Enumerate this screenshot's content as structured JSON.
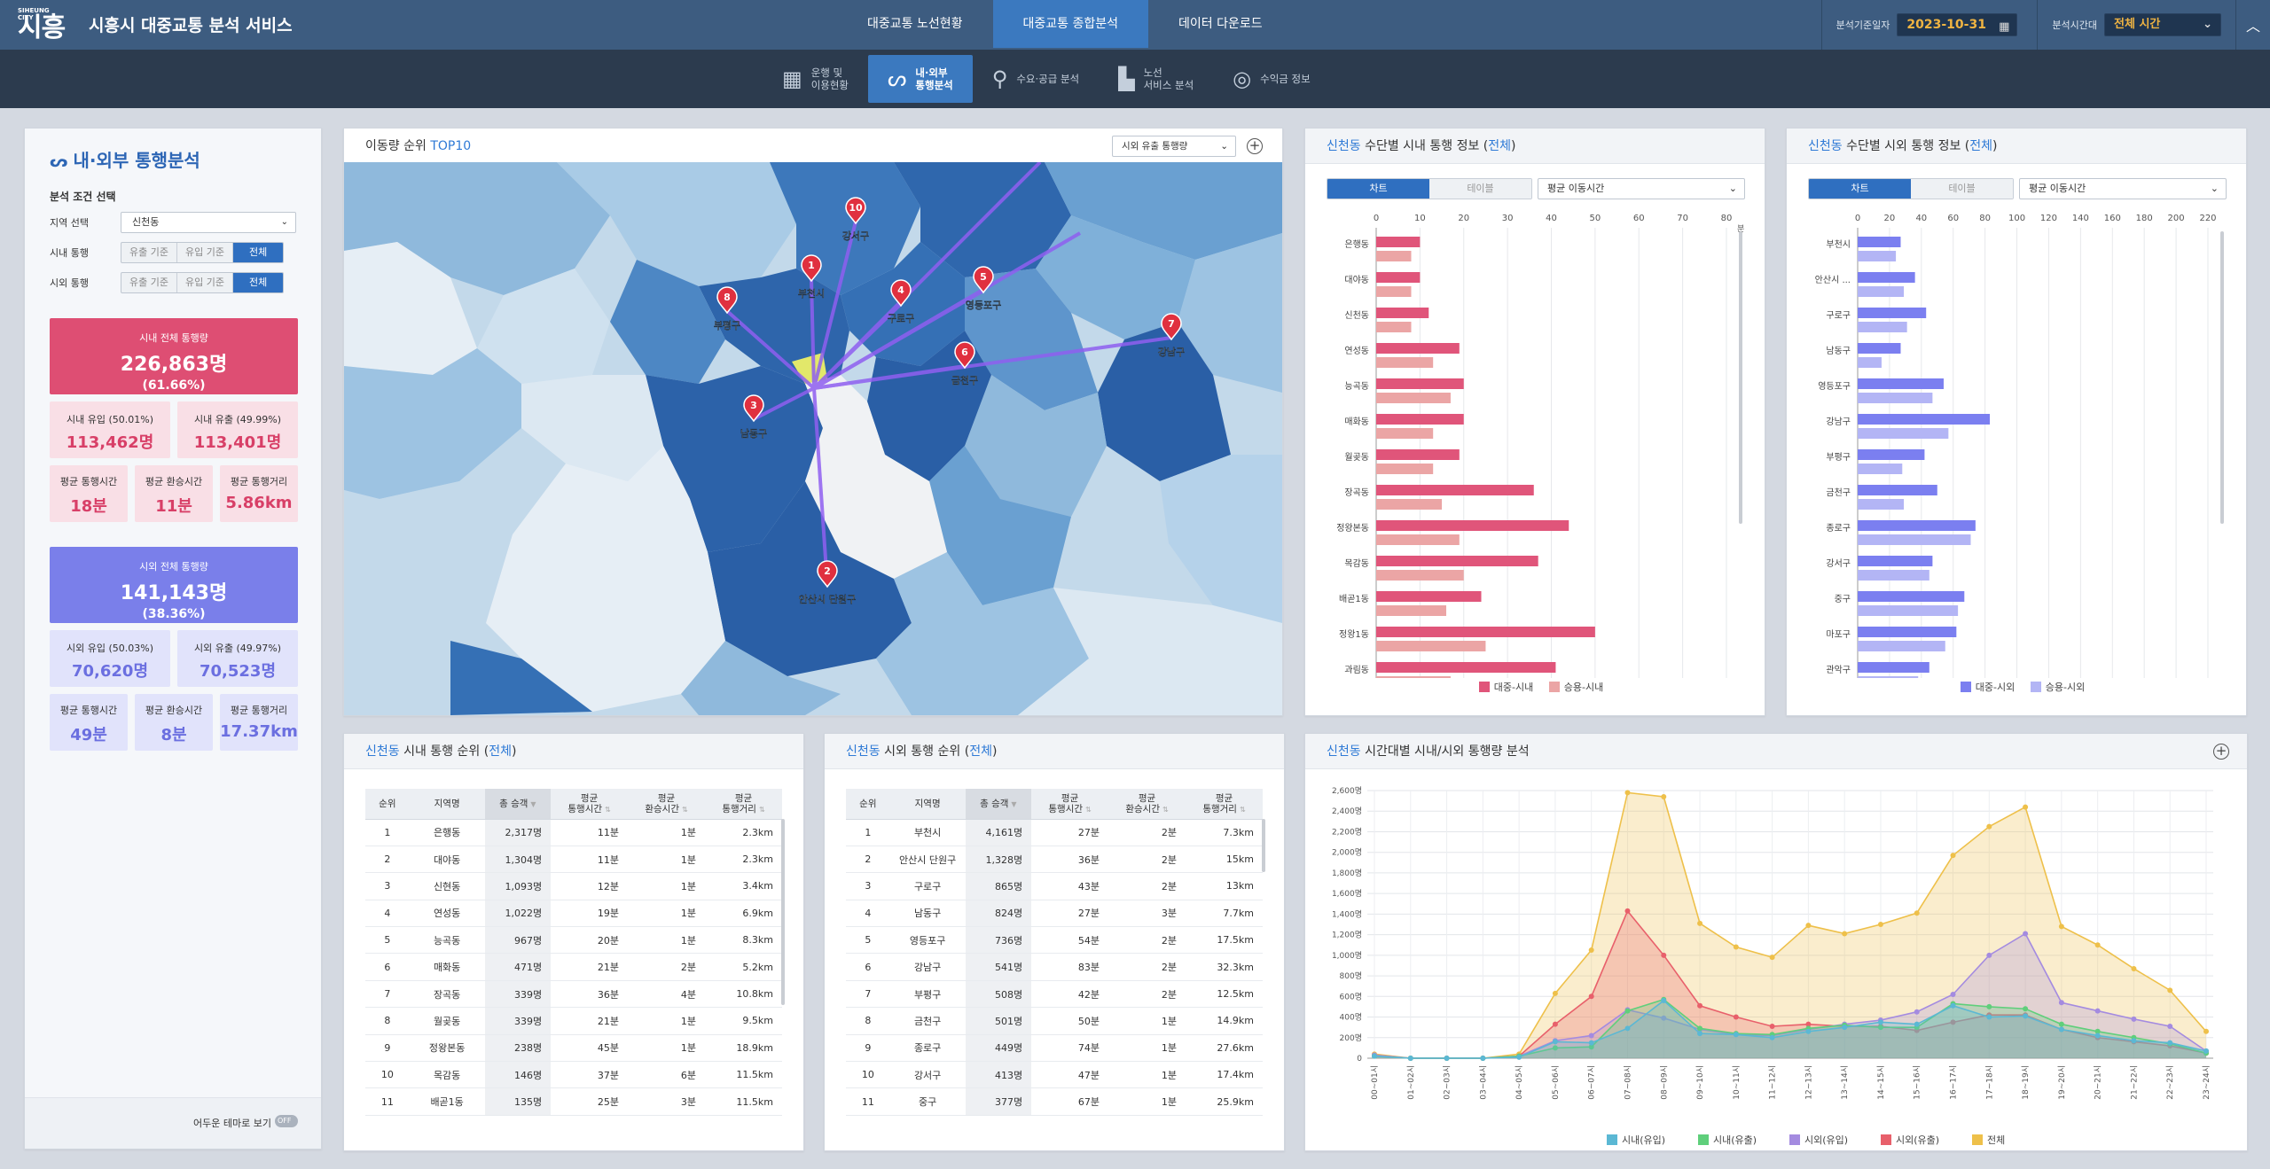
{
  "header": {
    "logo_small": "SIHEUNG CITY",
    "logo": "시흥",
    "title": "시흥시 대중교통 분석 서비스",
    "nav": [
      "대중교통 노선현황",
      "대중교통 종합분석",
      "데이터 다운로드"
    ],
    "date_label": "분석기준일자",
    "date": "2023-10-31",
    "time_label": "분석시간대",
    "time": "전체 시간"
  },
  "subnav": [
    [
      "운행 및",
      "이용현황"
    ],
    [
      "내·외부",
      "통행분석"
    ],
    [
      "수요·공급 분석",
      ""
    ],
    [
      "노선",
      "서비스 분석"
    ],
    [
      "수익금 정보",
      ""
    ]
  ],
  "left": {
    "title": "내·외부 통행분석",
    "cond": "분석 조건 선택",
    "region_label": "지역 선택",
    "region": "신천동",
    "inner_label": "시내 통행",
    "outer_label": "시외 통행",
    "seg": [
      "유출 기준",
      "유입 기준",
      "전체"
    ],
    "inner_total_label": "시내 전체 통행량",
    "inner_total": "226,863명",
    "inner_total_pct": "(61.66%)",
    "inner_in_label": "시내 유입 (50.01%)",
    "inner_in": "113,462명",
    "inner_out_label": "시내 유출 (49.99%)",
    "inner_out": "113,401명",
    "inner_stats": [
      [
        "평균 통행시간",
        "18분"
      ],
      [
        "평균 환승시간",
        "11분"
      ],
      [
        "평균 통행거리",
        "5.86km"
      ]
    ],
    "outer_total_label": "시외 전체 통행량",
    "outer_total": "141,143명",
    "outer_total_pct": "(38.36%)",
    "outer_in_label": "시외 유입 (50.03%)",
    "outer_in": "70,620명",
    "outer_out_label": "시외 유출 (49.97%)",
    "outer_out": "70,523명",
    "outer_stats": [
      [
        "평균 통행시간",
        "49분"
      ],
      [
        "평균 환승시간",
        "8분"
      ],
      [
        "평균 통행거리",
        "17.37km"
      ]
    ],
    "dark_label": "어두운 테마로 보기",
    "dark_state": "OFF"
  },
  "map": {
    "title_pre": "이동량 순위 ",
    "title_hl": "TOP10",
    "select": "시외 유출 통행량",
    "markers": [
      {
        "n": "1",
        "name": "부천시"
      },
      {
        "n": "2",
        "name": "안산시 단원구"
      },
      {
        "n": "3",
        "name": "남동구"
      },
      {
        "n": "4",
        "name": "구로구"
      },
      {
        "n": "5",
        "name": "영등포구"
      },
      {
        "n": "6",
        "name": "금천구"
      },
      {
        "n": "7",
        "name": "강남구"
      },
      {
        "n": "8",
        "name": "부평구"
      },
      {
        "n": "10",
        "name": "강서구"
      }
    ]
  },
  "inner_chart": {
    "title_pre": "신천동",
    "title_mid": " 수단별 시내 통행 정보 (",
    "title_hl": "전체",
    "title_end": ")",
    "tabs": [
      "차트",
      "테이블"
    ],
    "select": "평균 이동시간",
    "unit": "분",
    "legend": [
      "대중-시내",
      "승용-시내"
    ],
    "colors": [
      "#e0557a",
      "#eba5a5"
    ]
  },
  "outer_chart": {
    "title_pre": "신천동",
    "title_mid": " 수단별 시외 통행 정보 (",
    "title_hl": "전체",
    "title_end": ")",
    "tabs": [
      "차트",
      "테이블"
    ],
    "select": "평균 이동시간",
    "legend": [
      "대중-시외",
      "승용-시외"
    ],
    "colors": [
      "#7b7ff0",
      "#b3b5f5"
    ]
  },
  "inner_table": {
    "title_pre": "신천동",
    "title_mid": " 시내 통행 순위 (",
    "title_hl": "전체",
    "title_end": ")",
    "headers": [
      "순위",
      "지역명",
      "총 승객",
      "평균\n통행시간",
      "평균\n환승시간",
      "평균\n통행거리"
    ],
    "rows": [
      [
        "1",
        "은행동",
        "2,317명",
        "11분",
        "1분",
        "2.3km"
      ],
      [
        "2",
        "대야동",
        "1,304명",
        "11분",
        "1분",
        "2.3km"
      ],
      [
        "3",
        "신현동",
        "1,093명",
        "12분",
        "1분",
        "3.4km"
      ],
      [
        "4",
        "연성동",
        "1,022명",
        "19분",
        "1분",
        "6.9km"
      ],
      [
        "5",
        "능곡동",
        "967명",
        "20분",
        "1분",
        "8.3km"
      ],
      [
        "6",
        "매화동",
        "471명",
        "21분",
        "2분",
        "5.2km"
      ],
      [
        "7",
        "장곡동",
        "339명",
        "36분",
        "4분",
        "10.8km"
      ],
      [
        "8",
        "월곶동",
        "339명",
        "21분",
        "1분",
        "9.5km"
      ],
      [
        "9",
        "정왕본동",
        "238명",
        "45분",
        "1분",
        "18.9km"
      ],
      [
        "10",
        "목감동",
        "146명",
        "37분",
        "6분",
        "11.5km"
      ],
      [
        "11",
        "배곧1동",
        "135명",
        "25분",
        "3분",
        "11.5km"
      ]
    ]
  },
  "outer_table": {
    "title_pre": "신천동",
    "title_mid": " 시외 통행 순위 (",
    "title_hl": "전체",
    "title_end": ")",
    "headers": [
      "순위",
      "지역명",
      "총 승객",
      "평균\n통행시간",
      "평균\n환승시간",
      "평균\n통행거리"
    ],
    "rows": [
      [
        "1",
        "부천시",
        "4,161명",
        "27분",
        "2분",
        "7.3km"
      ],
      [
        "2",
        "안산시 단원구",
        "1,328명",
        "36분",
        "2분",
        "15km"
      ],
      [
        "3",
        "구로구",
        "865명",
        "43분",
        "2분",
        "13km"
      ],
      [
        "4",
        "남동구",
        "824명",
        "27분",
        "3분",
        "7.7km"
      ],
      [
        "5",
        "영등포구",
        "736명",
        "54분",
        "2분",
        "17.5km"
      ],
      [
        "6",
        "강남구",
        "541명",
        "83분",
        "2분",
        "32.3km"
      ],
      [
        "7",
        "부평구",
        "508명",
        "42분",
        "2분",
        "12.5km"
      ],
      [
        "8",
        "금천구",
        "501명",
        "50분",
        "1분",
        "14.9km"
      ],
      [
        "9",
        "종로구",
        "449명",
        "74분",
        "1분",
        "27.6km"
      ],
      [
        "10",
        "강서구",
        "413명",
        "47분",
        "1분",
        "17.4km"
      ],
      [
        "11",
        "중구",
        "377명",
        "67분",
        "1분",
        "25.9km"
      ]
    ]
  },
  "ts": {
    "title_pre": "신천동",
    "title_rest": " 시간대별 시내/시외 통행량 분석"
  },
  "chart_data": [
    {
      "type": "bar",
      "name": "inner",
      "categories": [
        "은행동",
        "대야동",
        "신천동",
        "연성동",
        "능곡동",
        "매화동",
        "월곶동",
        "장곡동",
        "정왕본동",
        "목감동",
        "배곧1동",
        "정왕1동",
        "과림동"
      ],
      "series": [
        {
          "name": "대중-시내",
          "values": [
            10,
            10,
            12,
            19,
            20,
            20,
            19,
            36,
            44,
            37,
            24,
            50,
            41
          ]
        },
        {
          "name": "승용-시내",
          "values": [
            8,
            8,
            8,
            13,
            17,
            13,
            13,
            15,
            19,
            20,
            16,
            25,
            17
          ]
        }
      ],
      "xlim": [
        0,
        80
      ],
      "xticks": [
        0,
        10,
        20,
        30,
        40,
        50,
        60,
        70,
        80
      ]
    },
    {
      "type": "bar",
      "name": "outer",
      "categories": [
        "부천시",
        "안산시 ...",
        "구로구",
        "남동구",
        "영등포구",
        "강남구",
        "부평구",
        "금천구",
        "종로구",
        "강서구",
        "중구",
        "마포구",
        "관악구"
      ],
      "series": [
        {
          "name": "대중-시외",
          "values": [
            27,
            36,
            43,
            27,
            54,
            83,
            42,
            50,
            74,
            47,
            67,
            62,
            45
          ]
        },
        {
          "name": "승용-시외",
          "values": [
            24,
            29,
            31,
            15,
            47,
            57,
            28,
            29,
            71,
            45,
            63,
            55,
            38
          ]
        }
      ],
      "xlim": [
        0,
        220
      ],
      "xticks": [
        0,
        20,
        40,
        60,
        80,
        100,
        120,
        140,
        160,
        180,
        200,
        220
      ]
    },
    {
      "type": "area",
      "name": "hourly",
      "categories": [
        "00~01시",
        "01~02시",
        "02~03시",
        "03~04시",
        "04~05시",
        "05~06시",
        "06~07시",
        "07~08시",
        "08~09시",
        "09~10시",
        "10~11시",
        "11~12시",
        "12~13시",
        "13~14시",
        "14~15시",
        "15~16시",
        "16~17시",
        "17~18시",
        "18~19시",
        "19~20시",
        "20~21시",
        "21~22시",
        "22~23시",
        "23~24시"
      ],
      "series": [
        {
          "name": "시내(유입)",
          "color": "#5bb8d4",
          "values": [
            20,
            0,
            0,
            0,
            10,
            160,
            150,
            290,
            560,
            240,
            230,
            200,
            260,
            300,
            350,
            330,
            510,
            400,
            410,
            280,
            220,
            170,
            150,
            70
          ]
        },
        {
          "name": "시내(유출)",
          "color": "#5fcf7b",
          "values": [
            20,
            0,
            0,
            0,
            20,
            100,
            110,
            460,
            570,
            290,
            240,
            230,
            290,
            320,
            300,
            300,
            530,
            500,
            480,
            330,
            260,
            200,
            140,
            50
          ]
        },
        {
          "name": "시외(유입)",
          "color": "#a48be0",
          "values": [
            30,
            0,
            0,
            0,
            20,
            170,
            220,
            470,
            390,
            280,
            230,
            220,
            280,
            330,
            370,
            450,
            620,
            1000,
            1210,
            540,
            460,
            380,
            310,
            70
          ]
        },
        {
          "name": "시외(유출)",
          "color": "#e8606b",
          "values": [
            30,
            0,
            0,
            0,
            20,
            330,
            600,
            1430,
            1000,
            510,
            400,
            310,
            330,
            310,
            310,
            270,
            350,
            420,
            420,
            280,
            200,
            160,
            120,
            50
          ]
        },
        {
          "name": "전체",
          "color": "#eec04a",
          "values": [
            40,
            0,
            0,
            0,
            40,
            630,
            1050,
            2580,
            2540,
            1310,
            1080,
            980,
            1290,
            1210,
            1300,
            1410,
            1970,
            2250,
            2440,
            1280,
            1100,
            870,
            660,
            260
          ]
        }
      ],
      "ylim": [
        0,
        2600
      ],
      "yticks": [
        0,
        200,
        400,
        600,
        800,
        1000,
        1200,
        1400,
        1600,
        1800,
        2000,
        2200,
        2400,
        2600
      ]
    }
  ]
}
